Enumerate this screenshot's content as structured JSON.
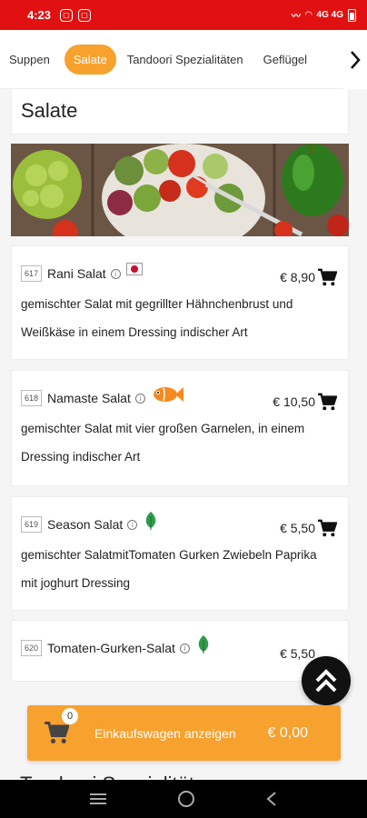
{
  "status": {
    "time": "4:23",
    "right": "4G 4G"
  },
  "tabs": [
    {
      "label": "Suppen"
    },
    {
      "label": "Salate",
      "active": true
    },
    {
      "label": "Tandoori Spezialitäten"
    },
    {
      "label": "Geflügel"
    }
  ],
  "section": {
    "title": "Salate",
    "next_title": "Tandoori Spezialitäten"
  },
  "items": [
    {
      "number": "617",
      "name": "Rani Salat",
      "price": "€ 8,90",
      "badge": "japan-flag-icon",
      "description": "gemischter Salat mit gegrillter Hähnchenbrust und Weißkäse in einem Dressing indischer Art"
    },
    {
      "number": "618",
      "name": "Namaste Salat",
      "price": "€ 10,50",
      "badge": "fish-icon",
      "description": "gemischter Salat mit vier großen Garnelen, in einem Dressing indischer Art"
    },
    {
      "number": "619",
      "name": "Season Salat",
      "price": "€ 5,50",
      "badge": "leaf-icon",
      "description": "gemischter SalatmitTomaten Gurken Zwiebeln Paprika mit joghurt Dressing"
    },
    {
      "number": "620",
      "name": "Tomaten-Gurken-Salat",
      "price": "€ 5,50",
      "badge": "leaf-icon",
      "description": ""
    }
  ],
  "cart": {
    "count": "0",
    "label": "Einkaufswagen anzeigen",
    "total": "€ 0,00"
  },
  "colors": {
    "accent": "#f7a12e",
    "statusbar": "#e21111"
  }
}
